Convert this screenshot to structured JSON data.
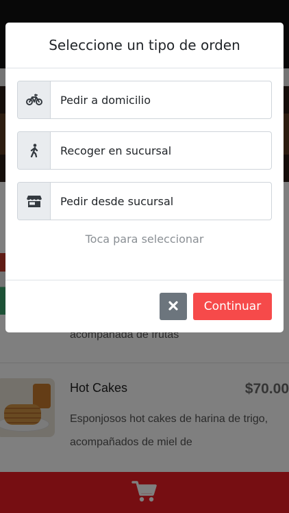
{
  "modal": {
    "title": "Seleccione un tipo de orden",
    "options": [
      {
        "label": "Pedir a domicilio",
        "icon": "bicycle-icon"
      },
      {
        "label": "Recoger en sucursal",
        "icon": "walking-person-icon"
      },
      {
        "label": "Pedir desde sucursal",
        "icon": "store-icon"
      }
    ],
    "hint": "Toca para seleccionar",
    "close_icon": "times-icon",
    "continue_label": "Continuar"
  },
  "background": {
    "prev_item_desc_tail": "acompañada de frutas",
    "item": {
      "title": "Hot Cakes",
      "price": "$70.00",
      "description": "Esponjosos hot cakes de harina de trigo, acompañados de miel de"
    },
    "cart_icon": "cart-icon"
  },
  "colors": {
    "continue_button": "#f64a4a",
    "close_button": "#6c757d",
    "cart_bar": "#ed1c24",
    "overlay": "rgba(0,0,0,0.5)"
  }
}
